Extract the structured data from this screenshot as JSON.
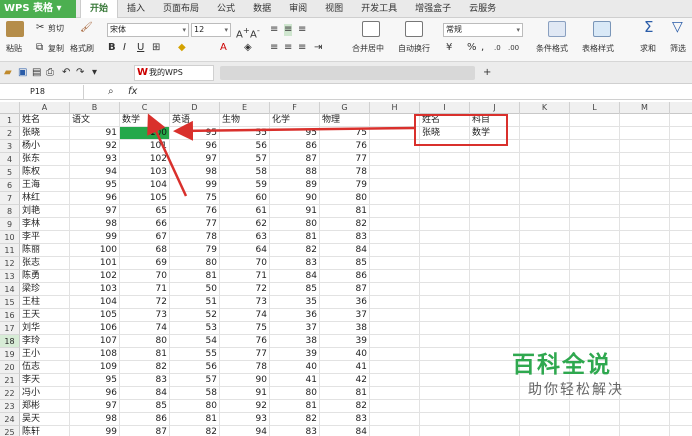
{
  "menubar": {
    "app_title": "WPS 表格",
    "menus": [
      "开始",
      "插入",
      "页面布局",
      "公式",
      "数据",
      "审阅",
      "视图",
      "开发工具",
      "增强盒子",
      "云服务"
    ]
  },
  "ribbon": {
    "paste": "粘贴",
    "cut": "剪切",
    "copy": "复制",
    "format_painter": "格式刷",
    "font_name": "宋体",
    "font_size": "12",
    "merge_center": "合并居中",
    "wrap_text": "自动换行",
    "number_format": "常规",
    "conditional_format": "条件格式",
    "table_style": "表格样式",
    "sum": "求和",
    "filter": "筛选"
  },
  "quick_access": {
    "file_tab": "我的WPS"
  },
  "formula_bar": {
    "name_box": "P18",
    "fx": "fx"
  },
  "sheet": {
    "columns": [
      "A",
      "B",
      "C",
      "D",
      "E",
      "F",
      "G",
      "H",
      "I",
      "J",
      "K",
      "L",
      "M",
      "N"
    ],
    "row_numbers": [
      "1",
      "2",
      "3",
      "4",
      "5",
      "6",
      "7",
      "8",
      "9",
      "10",
      "11",
      "12",
      "13",
      "14",
      "15",
      "16",
      "17",
      "18",
      "19",
      "20",
      "21",
      "22",
      "23",
      "24",
      "25"
    ],
    "headers": [
      "姓名",
      "语文",
      "数学",
      "英语",
      "生物",
      "化学",
      "物理"
    ],
    "rows": [
      [
        "张晓",
        "91",
        "100",
        "95",
        "55",
        "95",
        "75"
      ],
      [
        "杨小",
        "92",
        "101",
        "96",
        "56",
        "86",
        "76"
      ],
      [
        "张东",
        "93",
        "102",
        "97",
        "57",
        "87",
        "77"
      ],
      [
        "陈权",
        "94",
        "103",
        "98",
        "58",
        "88",
        "78"
      ],
      [
        "王海",
        "95",
        "104",
        "99",
        "59",
        "89",
        "79"
      ],
      [
        "林红",
        "96",
        "105",
        "75",
        "60",
        "90",
        "80"
      ],
      [
        "刘艳",
        "97",
        "65",
        "76",
        "61",
        "91",
        "81"
      ],
      [
        "李林",
        "98",
        "66",
        "77",
        "62",
        "80",
        "82"
      ],
      [
        "李平",
        "99",
        "67",
        "78",
        "63",
        "81",
        "83"
      ],
      [
        "陈丽",
        "100",
        "68",
        "79",
        "64",
        "82",
        "84"
      ],
      [
        "张志",
        "101",
        "69",
        "80",
        "70",
        "83",
        "85"
      ],
      [
        "陈勇",
        "102",
        "70",
        "81",
        "71",
        "84",
        "86"
      ],
      [
        "梁珍",
        "103",
        "71",
        "50",
        "72",
        "85",
        "87"
      ],
      [
        "王柱",
        "104",
        "72",
        "51",
        "73",
        "35",
        "36"
      ],
      [
        "王天",
        "105",
        "73",
        "52",
        "74",
        "36",
        "37"
      ],
      [
        "刘华",
        "106",
        "74",
        "53",
        "75",
        "37",
        "38"
      ],
      [
        "李玲",
        "107",
        "80",
        "54",
        "76",
        "38",
        "39"
      ],
      [
        "王小",
        "108",
        "81",
        "55",
        "77",
        "39",
        "40"
      ],
      [
        "伍志",
        "109",
        "82",
        "56",
        "78",
        "40",
        "41"
      ],
      [
        "李天",
        "95",
        "83",
        "57",
        "90",
        "41",
        "42"
      ],
      [
        "冯小",
        "96",
        "84",
        "58",
        "91",
        "80",
        "81"
      ],
      [
        "郑彬",
        "97",
        "85",
        "80",
        "92",
        "81",
        "82"
      ],
      [
        "吴天",
        "98",
        "86",
        "81",
        "93",
        "82",
        "83"
      ],
      [
        "陈轩",
        "99",
        "87",
        "82",
        "94",
        "83",
        "84"
      ]
    ],
    "lookup": {
      "header_name": "姓名",
      "header_subject": "科目",
      "value_name": "张晓",
      "value_subject": "数学"
    }
  },
  "watermark": {
    "line1": "百科全说",
    "line2": "助你轻松解决"
  },
  "colors": {
    "accent": "#4caf50",
    "highlight": "#24a84a",
    "annotation": "#d9302c"
  }
}
